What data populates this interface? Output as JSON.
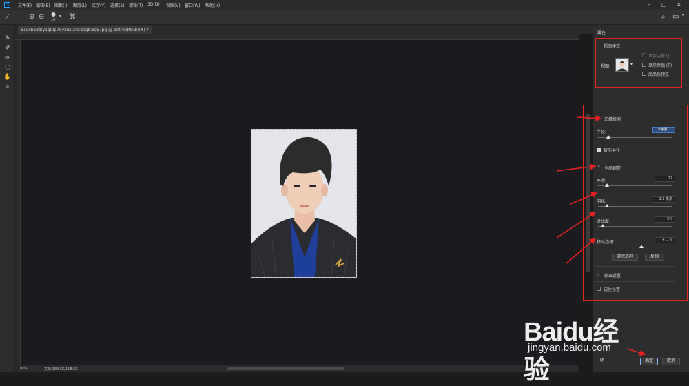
{
  "menubar": {
    "logo": "Ps",
    "items": [
      "文件(F)",
      "编辑(E)",
      "图像(I)",
      "图层(L)",
      "文字(Y)",
      "选择(S)",
      "滤镜(T)",
      "3D(D)",
      "视图(V)",
      "窗口(W)",
      "帮助(H)"
    ]
  },
  "options": {
    "brush_size": "10"
  },
  "document": {
    "tab_title": "61ecbb3dly1g9lp75yznkj20c80gbwg5.jpg @ 100%(RGB/8#) *"
  },
  "status": {
    "zoom": "100%",
    "doc_info": "文档:158.5K/158.5K"
  },
  "panel": {
    "title": "属性",
    "view_mode": {
      "heading": "视图模式",
      "view_label": "视图:",
      "show_edges": "显示边缘 (J)",
      "show_original": "显示原稿 (P)",
      "high_quality_preview": "高品质预览"
    },
    "edge_detection": {
      "heading": "边缘检测",
      "radius_label": "半径:",
      "radius_value": "0像素",
      "smart_radius": "智能半径"
    },
    "global_refine": {
      "heading": "全局调整",
      "smooth_label": "平滑:",
      "smooth_value": "12",
      "feather_label": "羽化:",
      "feather_value": "2.1 像素",
      "contrast_label": "对比度:",
      "contrast_value": "5%",
      "shift_edge_label": "移动边缘:",
      "shift_edge_value": "+11%",
      "clear_selection_button": "清除选区",
      "invert_button": "反相"
    },
    "output": {
      "heading": "输出设置"
    },
    "remember_settings": "记住设置",
    "ok_button": "确定",
    "cancel_button": "取消"
  },
  "watermark": {
    "brand": "Baidu经验",
    "url": "jingyan.baidu.com"
  },
  "colors": {
    "annotation": "#e62222",
    "ps_blue": "#31a8ff"
  }
}
